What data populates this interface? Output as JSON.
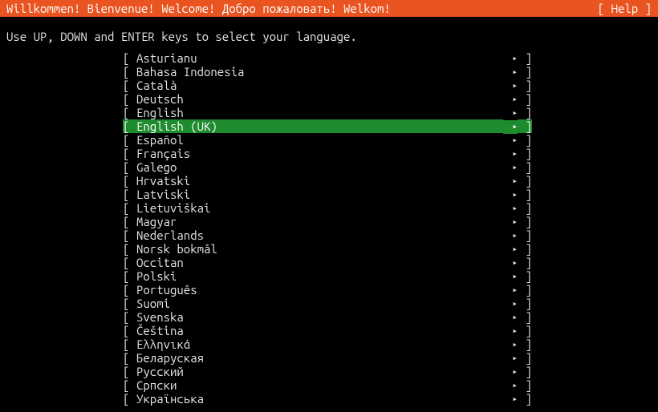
{
  "header": {
    "title": "Willkommen! Bienvenue! Welcome! Добро пожаловать! Welkom!",
    "help": "[ Help ]"
  },
  "instructions": "Use UP, DOWN and ENTER keys to select your language.",
  "bracket_open": "[ ",
  "bracket_close": " ]",
  "arrow_glyph": "▸",
  "selected_index": 5,
  "languages": [
    "Asturianu",
    "Bahasa Indonesia",
    "Català",
    "Deutsch",
    "English",
    "English (UK)",
    "Español",
    "Français",
    "Galego",
    "Hrvatski",
    "Latviski",
    "Lietuviškai",
    "Magyar",
    "Nederlands",
    "Norsk bokmål",
    "Occitan",
    "Polski",
    "Português",
    "Suomi",
    "Svenska",
    "Čeština",
    "Ελληνικά",
    "Беларуская",
    "Русский",
    "Српски",
    "Українська"
  ]
}
